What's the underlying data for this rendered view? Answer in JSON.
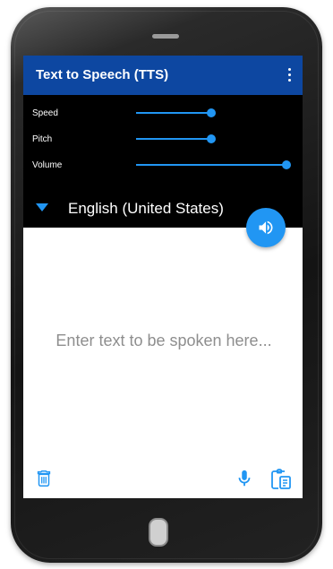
{
  "app": {
    "title": "Text to Speech (TTS)"
  },
  "controls": {
    "speed_label": "Speed",
    "pitch_label": "Pitch",
    "volume_label": "Volume",
    "speed_level": 0.5,
    "pitch_level": 0.5,
    "volume_level": 1.0
  },
  "language": {
    "selected": "English (United States)"
  },
  "input": {
    "placeholder": "Enter text to be spoken here..."
  },
  "icons": {
    "menu": "more-vert-icon",
    "speak": "volume-up-icon",
    "clear": "trash-icon",
    "voice_input": "microphone-icon",
    "paste": "paste-icon",
    "language_dropdown": "chevron-down-icon"
  },
  "colors": {
    "appbar": "#0d47a1",
    "accent": "#2196f3",
    "controls_bg": "#000000",
    "placeholder_text": "#8e8e8e"
  }
}
